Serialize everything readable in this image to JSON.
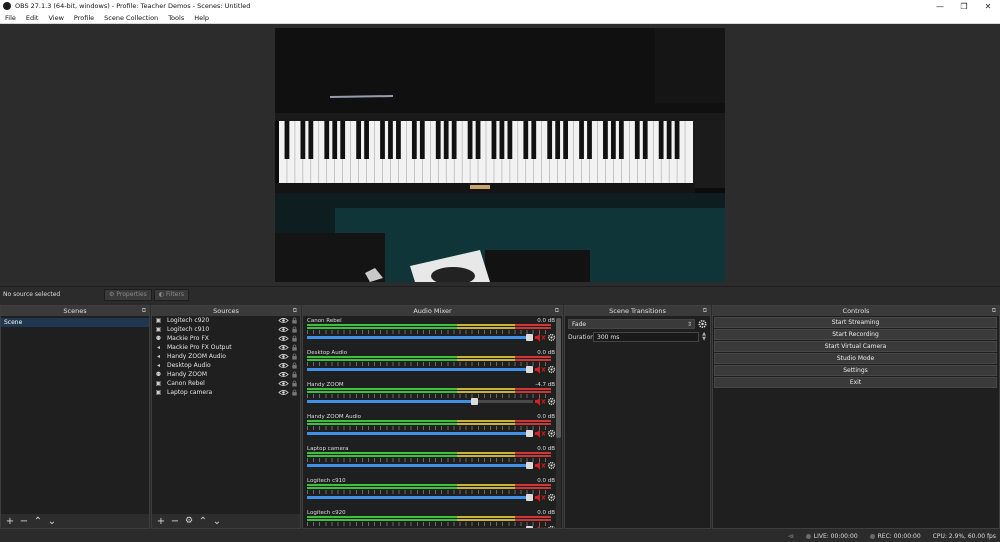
{
  "window": {
    "title": "OBS 27.1.3 (64-bit, windows) - Profile: Teacher Demos - Scenes: Untitled"
  },
  "menu": [
    "File",
    "Edit",
    "View",
    "Profile",
    "Scene Collection",
    "Tools",
    "Help"
  ],
  "context_bar": {
    "no_source": "No source selected",
    "properties": "Properties",
    "filters": "Filters"
  },
  "scenes": {
    "header": "Scenes",
    "items": [
      "Scene"
    ]
  },
  "sources": {
    "header": "Sources",
    "items": [
      {
        "name": "Logitech c920",
        "icon": "camera-icon"
      },
      {
        "name": "Logitech c910",
        "icon": "camera-icon"
      },
      {
        "name": "Mackie Pro FX",
        "icon": "microphone-icon"
      },
      {
        "name": "Mackie Pro FX Output",
        "icon": "speaker-icon"
      },
      {
        "name": "Handy ZOOM Audio",
        "icon": "speaker-icon"
      },
      {
        "name": "Desktop Audio",
        "icon": "speaker-icon"
      },
      {
        "name": "Handy ZOOM",
        "icon": "microphone-icon"
      },
      {
        "name": "Canon Rebel",
        "icon": "camera-icon"
      },
      {
        "name": "Laptop camera",
        "icon": "camera-icon"
      }
    ]
  },
  "mixer": {
    "header": "Audio Mixer",
    "channels": [
      {
        "name": "Canon Rebel",
        "db": "0.0 dB",
        "volume": 1.0
      },
      {
        "name": "Desktop Audio",
        "db": "0.0 dB",
        "volume": 1.0
      },
      {
        "name": "Handy ZOOM",
        "db": "-4.7 dB",
        "volume": 0.75
      },
      {
        "name": "Handy ZOOM Audio",
        "db": "0.0 dB",
        "volume": 1.0
      },
      {
        "name": "Laptop camera",
        "db": "0.0 dB",
        "volume": 1.0
      },
      {
        "name": "Logitech c910",
        "db": "0.0 dB",
        "volume": 1.0
      },
      {
        "name": "Logitech c920",
        "db": "0.0 dB",
        "volume": 1.0
      }
    ]
  },
  "transitions": {
    "header": "Scene Transitions",
    "selected": "Fade",
    "duration_label": "Duration",
    "duration_value": "300 ms"
  },
  "controls": {
    "header": "Controls",
    "buttons": [
      "Start Streaming",
      "Start Recording",
      "Start Virtual Camera",
      "Studio Mode",
      "Settings",
      "Exit"
    ]
  },
  "status": {
    "live": "LIVE: 00:00:00",
    "rec": "REC: 00:00:00",
    "cpu": "CPU: 2.9%, 60.00 fps"
  },
  "colors": {
    "meter_green": "#3fbf3f",
    "meter_yellow": "#c8b43a",
    "meter_red": "#c83a3a",
    "slider_blue": "#3f8ee8",
    "mute_red": "#d92020",
    "selected_scene": "#20384f"
  }
}
